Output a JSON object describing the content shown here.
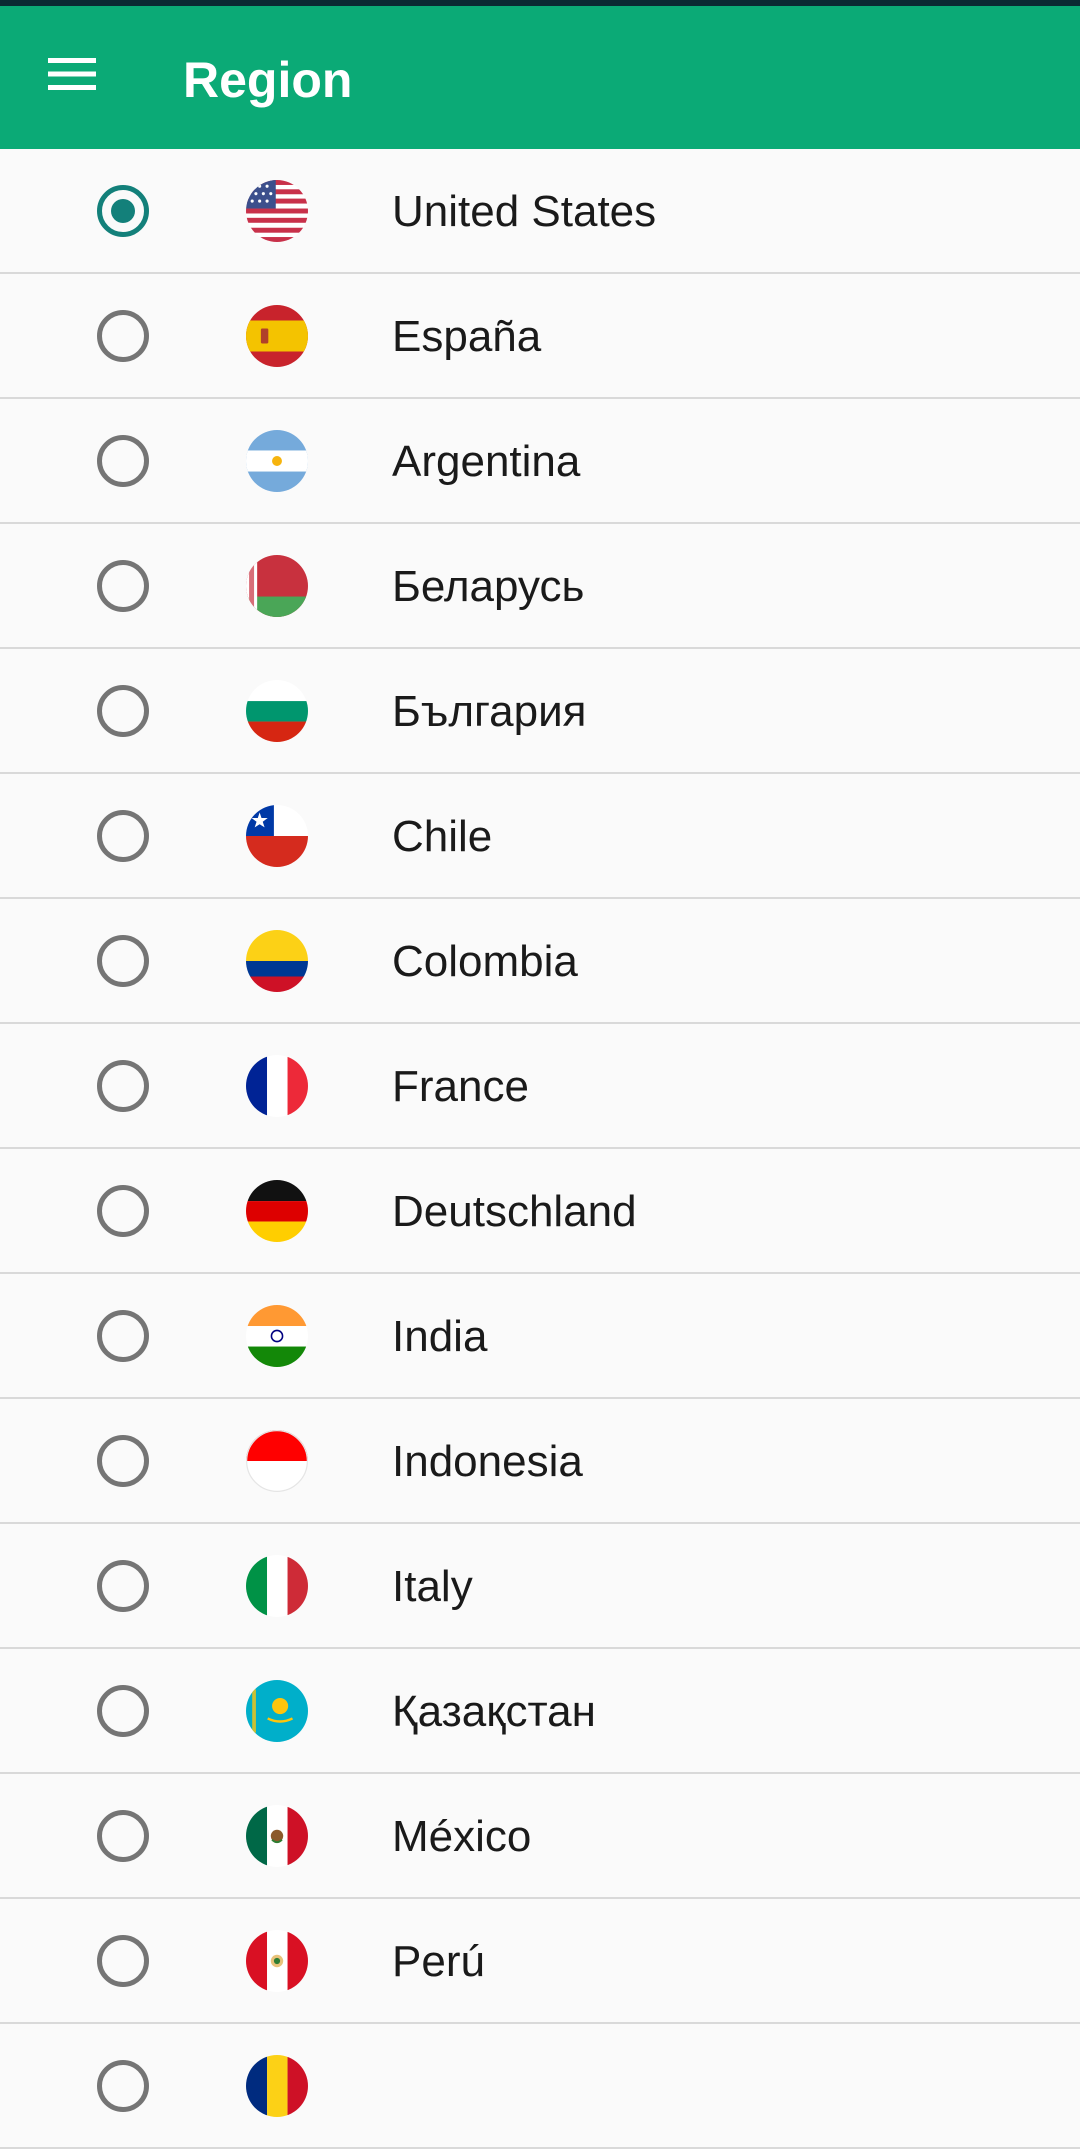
{
  "app_bar": {
    "title": "Region",
    "menu_icon": "hamburger-menu-icon",
    "background_color": "#0baa76"
  },
  "accent_color": "#13807a",
  "regions": [
    {
      "label": "United States",
      "selected": true,
      "flag": "us-flag-icon"
    },
    {
      "label": "España",
      "selected": false,
      "flag": "spain-flag-icon"
    },
    {
      "label": "Argentina",
      "selected": false,
      "flag": "argentina-flag-icon"
    },
    {
      "label": "Беларусь",
      "selected": false,
      "flag": "belarus-flag-icon"
    },
    {
      "label": "България",
      "selected": false,
      "flag": "bulgaria-flag-icon"
    },
    {
      "label": "Chile",
      "selected": false,
      "flag": "chile-flag-icon"
    },
    {
      "label": "Colombia",
      "selected": false,
      "flag": "colombia-flag-icon"
    },
    {
      "label": "France",
      "selected": false,
      "flag": "france-flag-icon"
    },
    {
      "label": "Deutschland",
      "selected": false,
      "flag": "germany-flag-icon"
    },
    {
      "label": "India",
      "selected": false,
      "flag": "india-flag-icon"
    },
    {
      "label": "Indonesia",
      "selected": false,
      "flag": "indonesia-flag-icon"
    },
    {
      "label": "Italy",
      "selected": false,
      "flag": "italy-flag-icon"
    },
    {
      "label": "Қазақстан",
      "selected": false,
      "flag": "kazakhstan-flag-icon"
    },
    {
      "label": "México",
      "selected": false,
      "flag": "mexico-flag-icon"
    },
    {
      "label": "Perú",
      "selected": false,
      "flag": "peru-flag-icon"
    },
    {
      "label": "",
      "selected": false,
      "flag": "romania-flag-icon"
    }
  ]
}
